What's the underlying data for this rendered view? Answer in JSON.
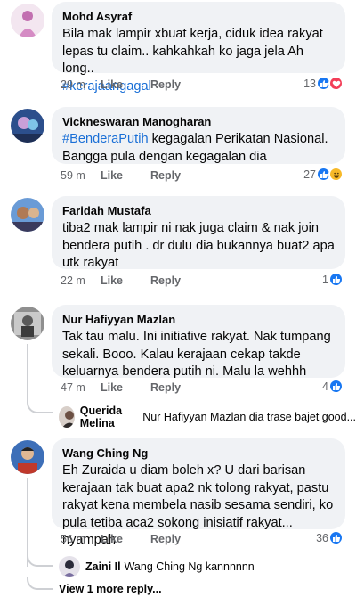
{
  "comments": [
    {
      "name": "Mohd Asyraf",
      "text": "Bila mak lampir xbuat kerja, ciduk idea rakyat lepas tu claim.. kahkahkah ko jaga jela Ah long..",
      "hashtag": "#kerajaangagal",
      "time": "29 m",
      "like": "Like",
      "reply": "Reply",
      "count": "13",
      "reactions": [
        "like-icon",
        "love-icon"
      ]
    },
    {
      "name": "Vickneswaran Manogharan",
      "hashtag": "#BenderaPutih",
      "text": " kegagalan Perikatan Nasional. Bangga pula dengan kegagalan dia",
      "time": "59 m",
      "like": "Like",
      "reply": "Reply",
      "count": "27",
      "reactions": [
        "like-icon",
        "haha-icon"
      ]
    },
    {
      "name": "Faridah Mustafa",
      "text": "tiba2 mak lampir ni nak juga claim & nak join bendera putih . dr dulu dia bukannya buat2 apa utk rakyat",
      "time": "22 m",
      "like": "Like",
      "reply": "Reply",
      "count": "1",
      "reactions": [
        "like-icon"
      ]
    },
    {
      "name": "Nur Hafiyyan Mazlan",
      "text": "Tak tau malu. Ini initiative rakyat. Nak tumpang sekali. Booo. Kalau kerajaan cekap takde keluarnya bendera putih ni. Malu la wehhh",
      "time": "47 m",
      "like": "Like",
      "reply": "Reply",
      "count": "4",
      "reactions": [
        "like-icon"
      ],
      "reply_preview": {
        "name": "Querida Melina",
        "text": "Nur Hafiyyan Mazlan dia trase bajet good..."
      }
    },
    {
      "name": "Wang Ching Ng",
      "text": "Eh Zuraida u diam boleh x? U dari barisan kerajaan tak buat apa2 nk tolong rakyat, pastu rakyat kena membela nasib sesama sendiri, ko pula tetiba aca2 sokong inisiatif rakyat... nyampah",
      "time": "56 m",
      "like": "Like",
      "reply": "Reply",
      "count": "36",
      "reactions": [
        "like-icon"
      ],
      "reply_preview": {
        "name": "Zaini Il",
        "text": "Wang Ching Ng kannnnnn"
      },
      "view_more": "View 1 more reply..."
    }
  ],
  "colors": {
    "bubble": "#f0f2f5",
    "link": "#1a6fd6",
    "like": "#1877f2",
    "love": "#f33e58",
    "haha": "#f7b928"
  }
}
